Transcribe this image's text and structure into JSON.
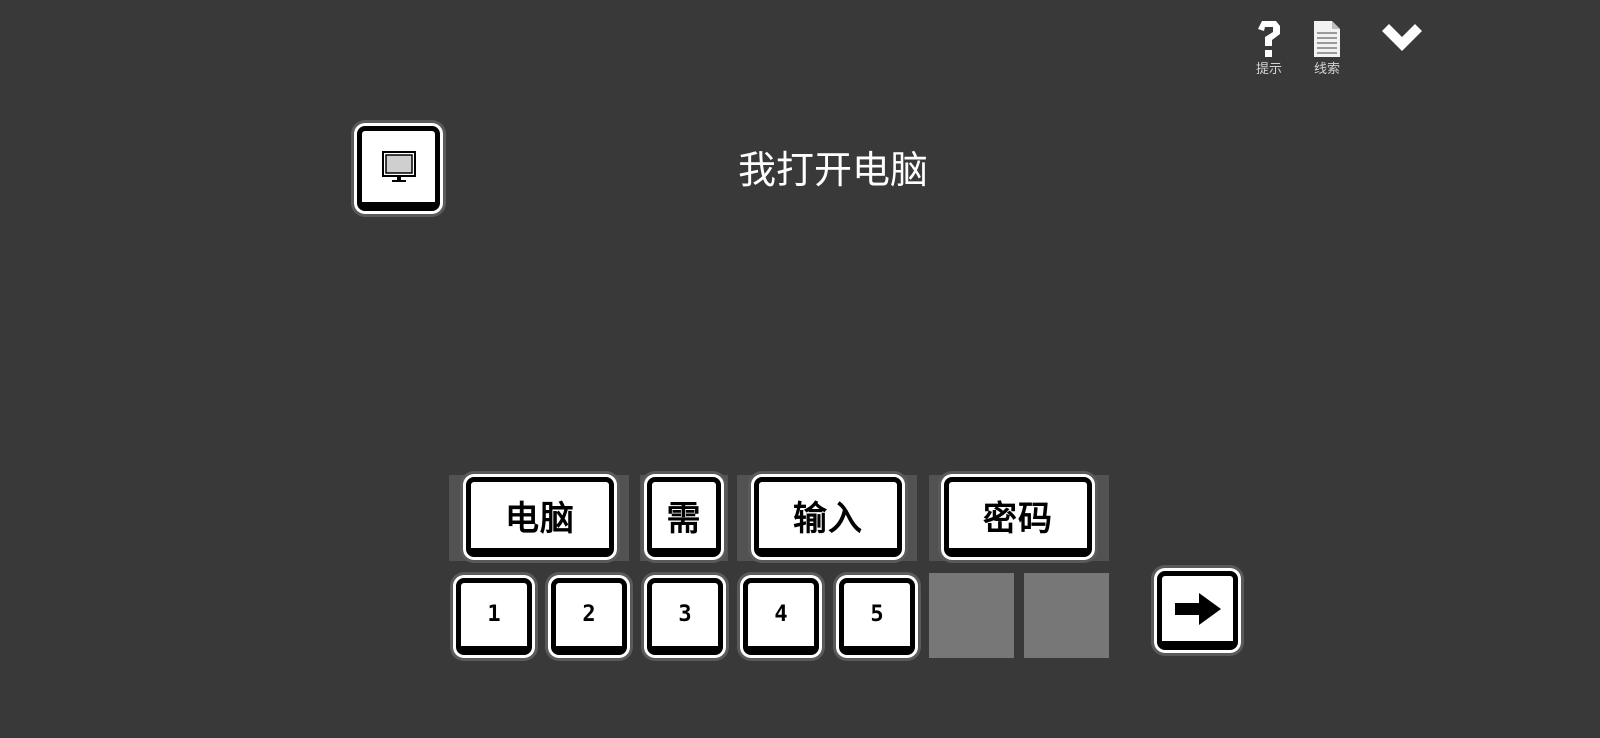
{
  "toolbar": {
    "hint_label": "提示",
    "clues_label": "线索",
    "hint_icon": "question-mark-icon",
    "clues_icon": "document-icon",
    "collapse_icon": "chevron-down-icon"
  },
  "scene": {
    "item_icon": "computer-monitor-icon",
    "sentence": "我打开电脑"
  },
  "word_tiles": [
    "电脑",
    "需",
    "输入",
    "密码"
  ],
  "number_tiles": [
    "1",
    "2",
    "3",
    "4",
    "5"
  ],
  "empty_slots": 2,
  "submit_icon": "arrow-right-icon",
  "colors": {
    "background": "#393939",
    "tile_fill": "#ffffff",
    "tile_border": "#000000",
    "empty_slot": "#777777"
  }
}
